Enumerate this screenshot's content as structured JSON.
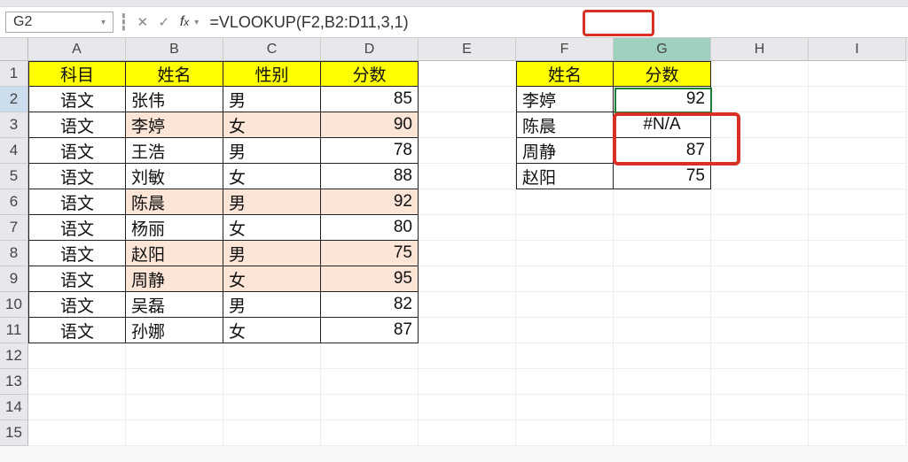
{
  "nameBox": "G2",
  "formula": {
    "pre": "=VLOOKUP(F2,",
    "range": "B2:D11",
    "post": ",3,1)"
  },
  "columns": [
    "A",
    "B",
    "C",
    "D",
    "E",
    "F",
    "G",
    "H",
    "I"
  ],
  "rowCount": 15,
  "hdr1": {
    "c1": "科目",
    "c2": "姓名",
    "c3": "性别",
    "c4": "分数"
  },
  "table1": [
    {
      "a": "语文",
      "b": "张伟",
      "c": "男",
      "d": "85",
      "peach": false
    },
    {
      "a": "语文",
      "b": "李婷",
      "c": "女",
      "d": "90",
      "peach": true
    },
    {
      "a": "语文",
      "b": "王浩",
      "c": "男",
      "d": "78",
      "peach": false
    },
    {
      "a": "语文",
      "b": "刘敏",
      "c": "女",
      "d": "88",
      "peach": false
    },
    {
      "a": "语文",
      "b": "陈晨",
      "c": "男",
      "d": "92",
      "peach": true
    },
    {
      "a": "语文",
      "b": "杨丽",
      "c": "女",
      "d": "80",
      "peach": false
    },
    {
      "a": "语文",
      "b": "赵阳",
      "c": "男",
      "d": "75",
      "peach": true
    },
    {
      "a": "语文",
      "b": "周静",
      "c": "女",
      "d": "95",
      "peach": true
    },
    {
      "a": "语文",
      "b": "吴磊",
      "c": "男",
      "d": "82",
      "peach": false
    },
    {
      "a": "语文",
      "b": "孙娜",
      "c": "女",
      "d": "87",
      "peach": false
    }
  ],
  "hdr2": {
    "c1": "姓名",
    "c2": "分数"
  },
  "table2": [
    {
      "f": "李婷",
      "g": "92"
    },
    {
      "f": "陈晨",
      "g": "#N/A"
    },
    {
      "f": "周静",
      "g": "87"
    },
    {
      "f": "赵阳",
      "g": "75"
    }
  ]
}
